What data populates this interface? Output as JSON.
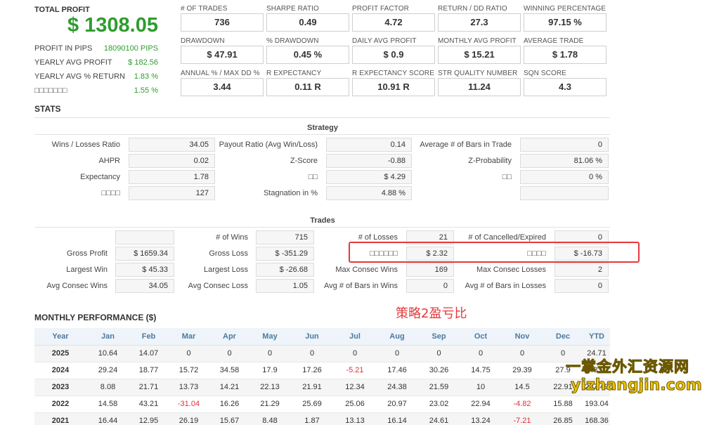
{
  "summary": {
    "total_profit_label": "TOTAL PROFIT",
    "total_profit_value": "$ 1308.05",
    "rows": [
      {
        "label": "PROFIT IN PIPS",
        "value": "18090100 PIPS"
      },
      {
        "label": "YEARLY AVG PROFIT",
        "value": "$ 182.56"
      },
      {
        "label": "YEARLY AVG % RETURN",
        "value": "1.83 %"
      },
      {
        "label": "□□□□□□□",
        "value": "1.55 %"
      }
    ]
  },
  "metrics": [
    {
      "label": "# OF TRADES",
      "value": "736"
    },
    {
      "label": "SHARPE RATIO",
      "value": "0.49"
    },
    {
      "label": "PROFIT FACTOR",
      "value": "4.72"
    },
    {
      "label": "RETURN / DD RATIO",
      "value": "27.3"
    },
    {
      "label": "WINNING PERCENTAGE",
      "value": "97.15 %"
    },
    {
      "label": "DRAWDOWN",
      "value": "$ 47.91"
    },
    {
      "label": "% DRAWDOWN",
      "value": "0.45 %"
    },
    {
      "label": "DAILY AVG PROFIT",
      "value": "$ 0.9"
    },
    {
      "label": "MONTHLY AVG PROFIT",
      "value": "$ 15.21"
    },
    {
      "label": "AVERAGE TRADE",
      "value": "$ 1.78"
    },
    {
      "label": "ANNUAL % / MAX DD %",
      "value": "3.44"
    },
    {
      "label": "R EXPECTANCY",
      "value": "0.11 R"
    },
    {
      "label": "R EXPECTANCY SCORE",
      "value": "10.91 R"
    },
    {
      "label": "STR QUALITY NUMBER",
      "value": "11.24"
    },
    {
      "label": "SQN SCORE",
      "value": "4.3"
    }
  ],
  "stats": {
    "title": "STATS",
    "strategy_title": "Strategy",
    "strategy": {
      "col1": [
        {
          "label": "Wins / Losses Ratio",
          "value": "34.05"
        },
        {
          "label": "AHPR",
          "value": "0.02"
        },
        {
          "label": "Expectancy",
          "value": "1.78"
        },
        {
          "label": "□□□□",
          "value": "127"
        }
      ],
      "col2": [
        {
          "label": "Payout Ratio (Avg Win/Loss)",
          "value": "0.14"
        },
        {
          "label": "Z-Score",
          "value": "-0.88"
        },
        {
          "label": "□□",
          "value": "$ 4.29"
        },
        {
          "label": "Stagnation in %",
          "value": "4.88 %"
        }
      ],
      "col3": [
        {
          "label": "Average # of Bars in Trade",
          "value": "0"
        },
        {
          "label": "Z-Probability",
          "value": "81.06 %"
        },
        {
          "label": "□□",
          "value": "0 %"
        },
        {
          "label": "",
          "value": ""
        }
      ]
    },
    "trades_title": "Trades",
    "trades": {
      "col1": [
        {
          "label": "",
          "value": ""
        },
        {
          "label": "Gross Profit",
          "value": "$ 1659.34"
        },
        {
          "label": "Largest Win",
          "value": "$ 45.33"
        },
        {
          "label": "Avg Consec Wins",
          "value": "34.05"
        }
      ],
      "col2": [
        {
          "label": "# of Wins",
          "value": "715"
        },
        {
          "label": "Gross Loss",
          "value": "$ -351.29"
        },
        {
          "label": "Largest Loss",
          "value": "$ -26.68"
        },
        {
          "label": "Avg Consec Loss",
          "value": "1.05"
        }
      ],
      "col3": [
        {
          "label": "# of Losses",
          "value": "21"
        },
        {
          "label": "□□□□□□",
          "value": "$ 2.32"
        },
        {
          "label": "Max Consec Wins",
          "value": "169"
        },
        {
          "label": "Avg # of Bars in Wins",
          "value": "0"
        }
      ],
      "col4": [
        {
          "label": "# of Cancelled/Expired",
          "value": "0"
        },
        {
          "label": "□□□□",
          "value": "$ -16.73"
        },
        {
          "label": "Max Consec Losses",
          "value": "2"
        },
        {
          "label": "Avg # of Bars in Losses",
          "value": "0"
        }
      ]
    }
  },
  "annotation": "策略2盈亏比",
  "monthly": {
    "title": "MONTHLY PERFORMANCE ($)",
    "headers": [
      "Year",
      "Jan",
      "Feb",
      "Mar",
      "Apr",
      "May",
      "Jun",
      "Jul",
      "Aug",
      "Sep",
      "Oct",
      "Nov",
      "Dec",
      "YTD"
    ],
    "rows": [
      [
        "2025",
        "10.64",
        "14.07",
        "0",
        "0",
        "0",
        "0",
        "0",
        "0",
        "0",
        "0",
        "0",
        "0",
        "24.71"
      ],
      [
        "2024",
        "29.24",
        "18.77",
        "15.72",
        "34.58",
        "17.9",
        "17.26",
        "-5.21",
        "17.46",
        "30.26",
        "14.75",
        "29.39",
        "27.9",
        "248.02"
      ],
      [
        "2023",
        "8.08",
        "21.71",
        "13.73",
        "14.21",
        "22.13",
        "21.91",
        "12.34",
        "24.38",
        "21.59",
        "10",
        "14.5",
        "22.91",
        "207.49"
      ],
      [
        "2022",
        "14.58",
        "43.21",
        "-31.04",
        "16.26",
        "21.29",
        "25.69",
        "25.06",
        "20.97",
        "23.02",
        "22.94",
        "-4.82",
        "15.88",
        "193.04"
      ],
      [
        "2021",
        "16.44",
        "12.95",
        "26.19",
        "15.67",
        "8.48",
        "1.87",
        "13.13",
        "16.14",
        "24.61",
        "13.24",
        "-7.21",
        "26.85",
        "168.36"
      ]
    ]
  },
  "watermark": {
    "line1": "一掌金外汇资源网",
    "line2": "yizhangjin.com"
  },
  "colors": {
    "profit_green": "#2e9d2e",
    "negative_red": "#e0303a",
    "annotation_red": "#e5383b",
    "header_blue": "#4c7aa0"
  }
}
